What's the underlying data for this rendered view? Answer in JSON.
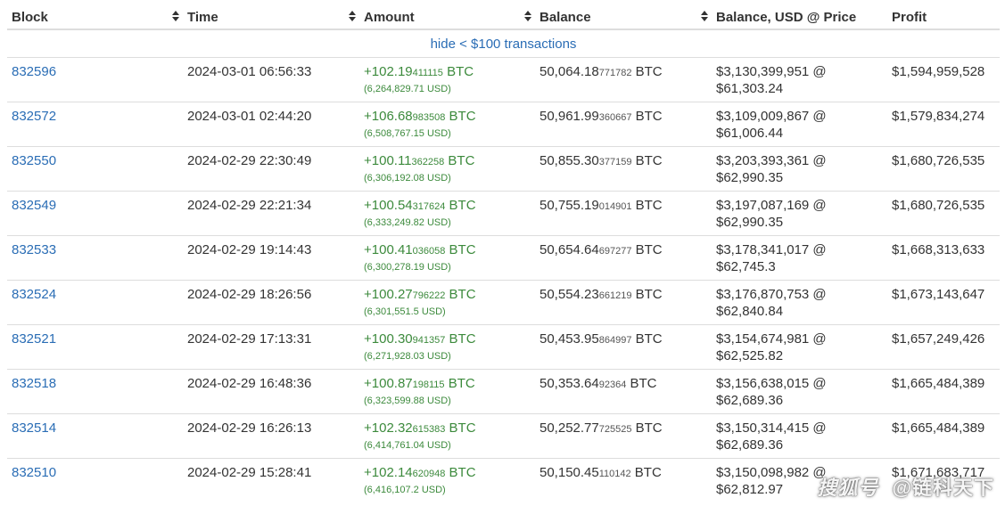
{
  "headers": {
    "block": "Block",
    "time": "Time",
    "amount": "Amount",
    "balance": "Balance",
    "balance_usd": "Balance, USD @ Price",
    "profit": "Profit"
  },
  "hide_link": "hide < $100 transactions",
  "rows": [
    {
      "block": "832596",
      "time": "2024-03-01 06:56:33",
      "amt_main": "+102.19",
      "amt_small": "411115",
      "amt_unit": " BTC",
      "amt_usd": "(6,264,829.71 USD)",
      "bal_main": "50,064.18",
      "bal_small": "771782",
      "bal_unit": " BTC",
      "bal_usd": "$3,130,399,951 @",
      "price": "$61,303.24",
      "profit": "$1,594,959,528"
    },
    {
      "block": "832572",
      "time": "2024-03-01 02:44:20",
      "amt_main": "+106.68",
      "amt_small": "983508",
      "amt_unit": " BTC",
      "amt_usd": "(6,508,767.15 USD)",
      "bal_main": "50,961.99",
      "bal_small": "360667",
      "bal_unit": " BTC",
      "bal_usd": "$3,109,009,867 @",
      "price": "$61,006.44",
      "profit": "$1,579,834,274"
    },
    {
      "block": "832550",
      "time": "2024-02-29 22:30:49",
      "amt_main": "+100.11",
      "amt_small": "362258",
      "amt_unit": " BTC",
      "amt_usd": "(6,306,192.08 USD)",
      "bal_main": "50,855.30",
      "bal_small": "377159",
      "bal_unit": " BTC",
      "bal_usd": "$3,203,393,361 @",
      "price": "$62,990.35",
      "profit": "$1,680,726,535"
    },
    {
      "block": "832549",
      "time": "2024-02-29 22:21:34",
      "amt_main": "+100.54",
      "amt_small": "317624",
      "amt_unit": " BTC",
      "amt_usd": "(6,333,249.82 USD)",
      "bal_main": "50,755.19",
      "bal_small": "014901",
      "bal_unit": " BTC",
      "bal_usd": "$3,197,087,169 @",
      "price": "$62,990.35",
      "profit": "$1,680,726,535"
    },
    {
      "block": "832533",
      "time": "2024-02-29 19:14:43",
      "amt_main": "+100.41",
      "amt_small": "036058",
      "amt_unit": " BTC",
      "amt_usd": "(6,300,278.19 USD)",
      "bal_main": "50,654.64",
      "bal_small": "697277",
      "bal_unit": " BTC",
      "bal_usd": "$3,178,341,017 @",
      "price": "$62,745.3",
      "profit": "$1,668,313,633"
    },
    {
      "block": "832524",
      "time": "2024-02-29 18:26:56",
      "amt_main": "+100.27",
      "amt_small": "796222",
      "amt_unit": " BTC",
      "amt_usd": "(6,301,551.5 USD)",
      "bal_main": "50,554.23",
      "bal_small": "661219",
      "bal_unit": " BTC",
      "bal_usd": "$3,176,870,753 @",
      "price": "$62,840.84",
      "profit": "$1,673,143,647"
    },
    {
      "block": "832521",
      "time": "2024-02-29 17:13:31",
      "amt_main": "+100.30",
      "amt_small": "941357",
      "amt_unit": " BTC",
      "amt_usd": "(6,271,928.03 USD)",
      "bal_main": "50,453.95",
      "bal_small": "864997",
      "bal_unit": " BTC",
      "bal_usd": "$3,154,674,981 @",
      "price": "$62,525.82",
      "profit": "$1,657,249,426"
    },
    {
      "block": "832518",
      "time": "2024-02-29 16:48:36",
      "amt_main": "+100.87",
      "amt_small": "198115",
      "amt_unit": " BTC",
      "amt_usd": "(6,323,599.88 USD)",
      "bal_main": "50,353.64",
      "bal_small": "92364",
      "bal_unit": " BTC",
      "bal_usd": "$3,156,638,015 @",
      "price": "$62,689.36",
      "profit": "$1,665,484,389"
    },
    {
      "block": "832514",
      "time": "2024-02-29 16:26:13",
      "amt_main": "+102.32",
      "amt_small": "615383",
      "amt_unit": " BTC",
      "amt_usd": "(6,414,761.04 USD)",
      "bal_main": "50,252.77",
      "bal_small": "725525",
      "bal_unit": " BTC",
      "bal_usd": "$3,150,314,415 @",
      "price": "$62,689.36",
      "profit": "$1,665,484,389"
    },
    {
      "block": "832510",
      "time": "2024-02-29 15:28:41",
      "amt_main": "+102.14",
      "amt_small": "620948",
      "amt_unit": " BTC",
      "amt_usd": "(6,416,107.2 USD)",
      "bal_main": "50,150.45",
      "bal_small": "110142",
      "bal_unit": " BTC",
      "bal_usd": "$3,150,098,982 @",
      "price": "$62,812.97",
      "profit": "$1,671,683,717"
    }
  ],
  "watermark": {
    "logo": "搜狐号",
    "account": "@链科天下"
  }
}
